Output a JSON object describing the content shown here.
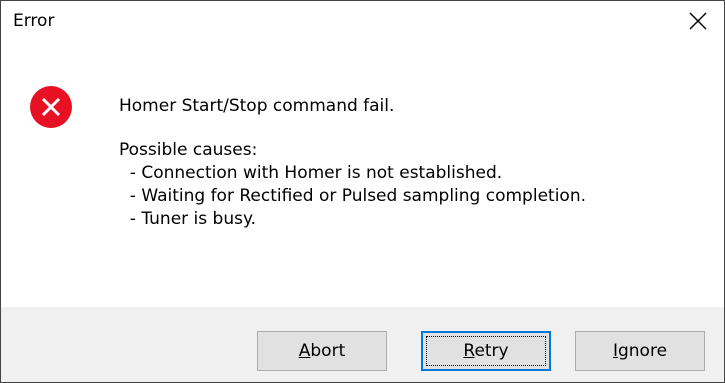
{
  "window": {
    "title": "Error"
  },
  "dialog": {
    "message": "Homer Start/Stop command fail.",
    "causes_heading": "Possible causes:",
    "causes": [
      "  - Connection with Homer is not established.",
      "  - Waiting for Rectified or Pulsed sampling completion.",
      "  - Tuner is busy."
    ],
    "icon": "error-icon",
    "icon_color": "#e81123"
  },
  "buttons": {
    "abort": {
      "mnemonic": "A",
      "rest": "bort"
    },
    "retry": {
      "mnemonic": "R",
      "rest": "etry"
    },
    "ignore": {
      "mnemonic": "I",
      "rest": "gnore"
    }
  },
  "colors": {
    "accent": "#0078d7",
    "footer_bg": "#f0f0f0",
    "button_bg": "#e1e1e1"
  }
}
